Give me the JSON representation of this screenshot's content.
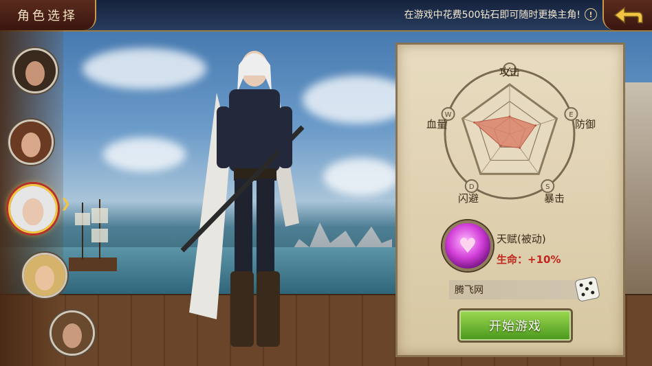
{
  "header": {
    "title": "角色选择",
    "notice": "在游戏中花费500钻石即可随时更换主角!",
    "notice_icon": "exclamation-icon",
    "back_icon": "back-arrow-icon"
  },
  "portraits": [
    {
      "name": "portrait-1",
      "hair": "#3a2a1e",
      "skin": "#c89478",
      "selected": false
    },
    {
      "name": "portrait-2",
      "hair": "#6b3a22",
      "skin": "#d9a88a",
      "selected": false
    },
    {
      "name": "portrait-3",
      "hair": "#e6e6e6",
      "skin": "#e8c6b0",
      "selected": true
    },
    {
      "name": "portrait-4",
      "hair": "#d6b36a",
      "skin": "#e8c39e",
      "selected": false
    },
    {
      "name": "portrait-5",
      "hair": "#6a4a2e",
      "skin": "#c99a7c",
      "selected": false
    }
  ],
  "stats_panel": {
    "axes": [
      "攻击",
      "防御",
      "暴击",
      "闪避",
      "血量"
    ],
    "axis_icons": [
      "A",
      "E",
      "S",
      "D",
      "W"
    ],
    "chart_data": {
      "type": "radar",
      "categories": [
        "攻击",
        "防御",
        "暴击",
        "闪避",
        "血量"
      ],
      "values": [
        0.35,
        0.55,
        0.35,
        0.3,
        0.75
      ],
      "ylim": [
        0,
        1
      ],
      "fill_color": "#d9826b"
    },
    "talent": {
      "title": "天赋(被动)",
      "stat": "生命：+10%",
      "icon": "heart-icon"
    },
    "name_field": {
      "value": "腾飞网"
    },
    "dice_icon": "dice-icon",
    "start_button": "开始游戏"
  },
  "colors": {
    "accent_gold": "#f1c542",
    "start_green": "#6fb52f",
    "panel_bg": "#e2d5b7"
  }
}
